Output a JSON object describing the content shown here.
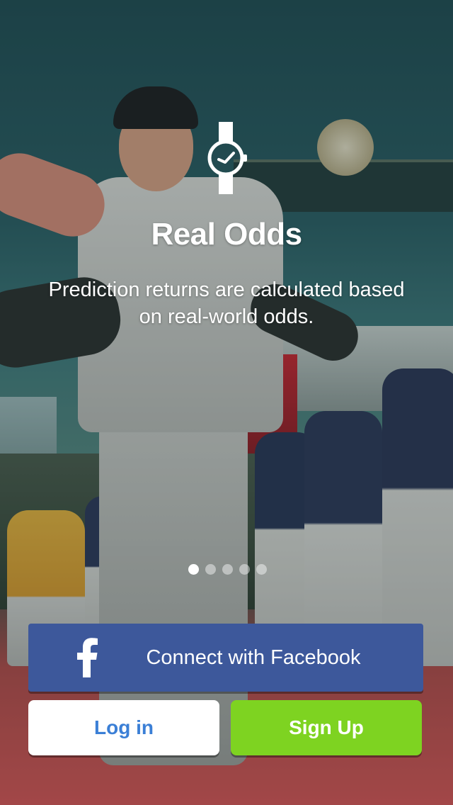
{
  "onboarding": {
    "title": "Real Odds",
    "subtitle": "Prediction returns are calculated based on real-world odds.",
    "icon": "watch-icon",
    "page_indicator": {
      "total": 5,
      "current": 1
    }
  },
  "actions": {
    "facebook_label": "Connect with Facebook",
    "facebook_icon": "facebook-icon",
    "login_label": "Log in",
    "signup_label": "Sign Up"
  },
  "colors": {
    "facebook": "#3d589b",
    "signup": "#7ed321",
    "login_text": "#3b7fd6"
  }
}
